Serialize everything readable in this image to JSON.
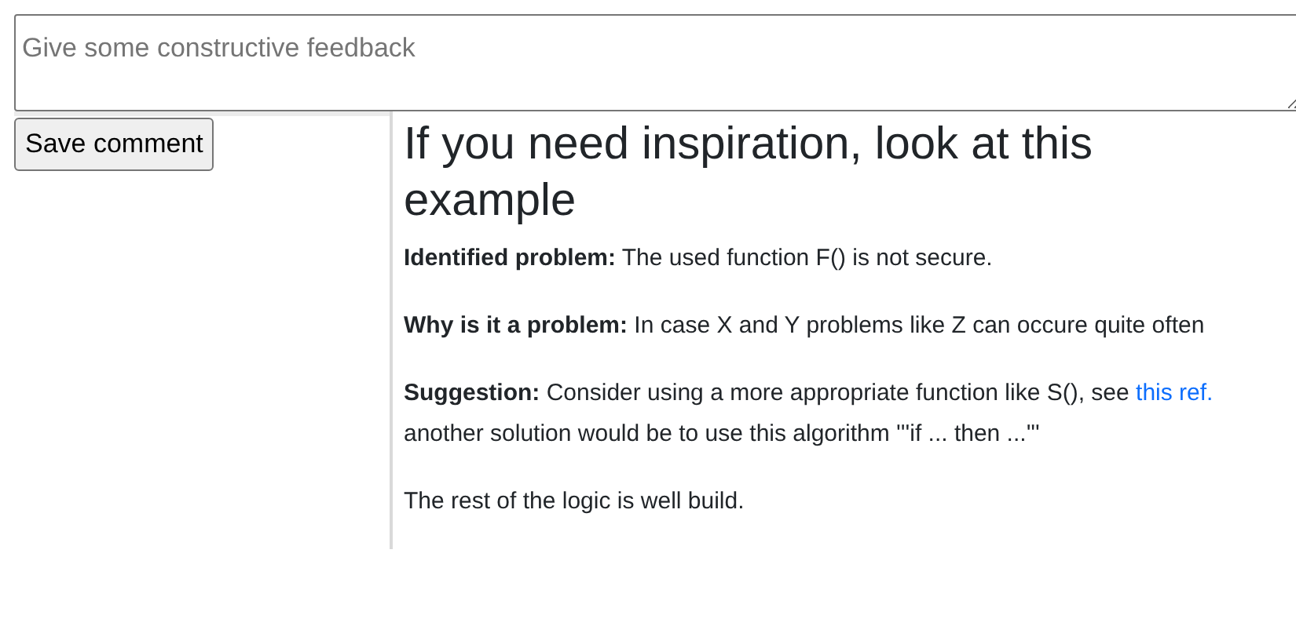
{
  "comment_field": {
    "placeholder": "Give some constructive feedback"
  },
  "save_button": "Save comment",
  "example": {
    "heading": "If you need inspiration, look at this example",
    "paragraphs": [
      {
        "text": "**Identified problem:** The used function F() is not secure."
      },
      {
        "text": "**Why is it a problem:** In case X and Y problems like Z can occure quite often"
      },
      {
        "text": "**Suggestion:** Consider using a more appropriate function like S(), see",
        "link": "this ref.",
        "extra": "another solution would be to use this algorithm '''if ... then ...'''"
      },
      {
        "text": "The rest of the logic is well build."
      }
    ]
  }
}
